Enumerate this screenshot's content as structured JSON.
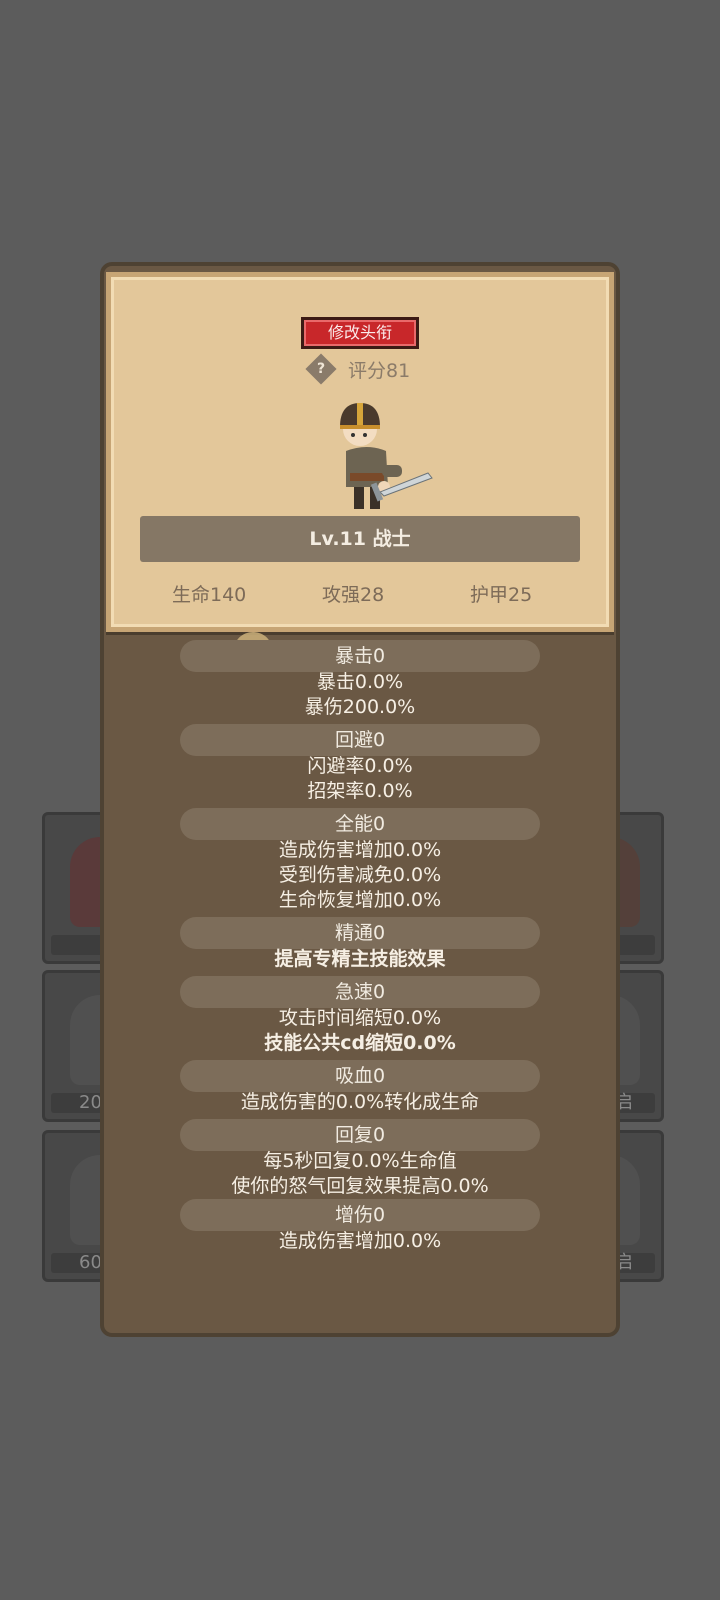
{
  "header": {
    "title_button": "修改头衔",
    "score": "评分81"
  },
  "hero": {
    "level_label": "Lv.11 战士"
  },
  "stats": {
    "hp": "生命140",
    "attack": "攻强28",
    "armor": "护甲25"
  },
  "attributes": {
    "crit": {
      "label": "暴击0",
      "lines": [
        "暴击0.0%",
        "暴伤200.0%"
      ]
    },
    "dodge": {
      "label": "回避0",
      "lines": [
        "闪避率0.0%",
        "招架率0.0%"
      ]
    },
    "versatility": {
      "label": "全能0",
      "lines": [
        "造成伤害增加0.0%",
        "受到伤害减免0.0%",
        "生命恢复增加0.0%"
      ]
    },
    "mastery": {
      "label": "精通0",
      "lines": [
        "提高专精主技能效果"
      ]
    },
    "haste": {
      "label": "急速0",
      "lines": [
        "攻击时间缩短0.0%",
        "技能公共cd缩短0.0%"
      ]
    },
    "leech": {
      "label": "吸血0",
      "lines": [
        "造成伤害的0.0%转化成生命"
      ]
    },
    "regen": {
      "label": "回复0",
      "lines": [
        "每5秒回复0.0%生命值",
        "使你的怒气回复效果提高0.0%"
      ]
    },
    "damage_up": {
      "label": "增伤0",
      "lines": [
        "造成伤害增加0.0%"
      ]
    }
  },
  "background_slots": {
    "left_mid": "20",
    "left_bottom": "60",
    "right_mid": "启",
    "right_bottom": "启"
  },
  "colors": {
    "title_button": "#c8272a",
    "parchment": "#e3c79a",
    "panel": "#6a5844"
  }
}
